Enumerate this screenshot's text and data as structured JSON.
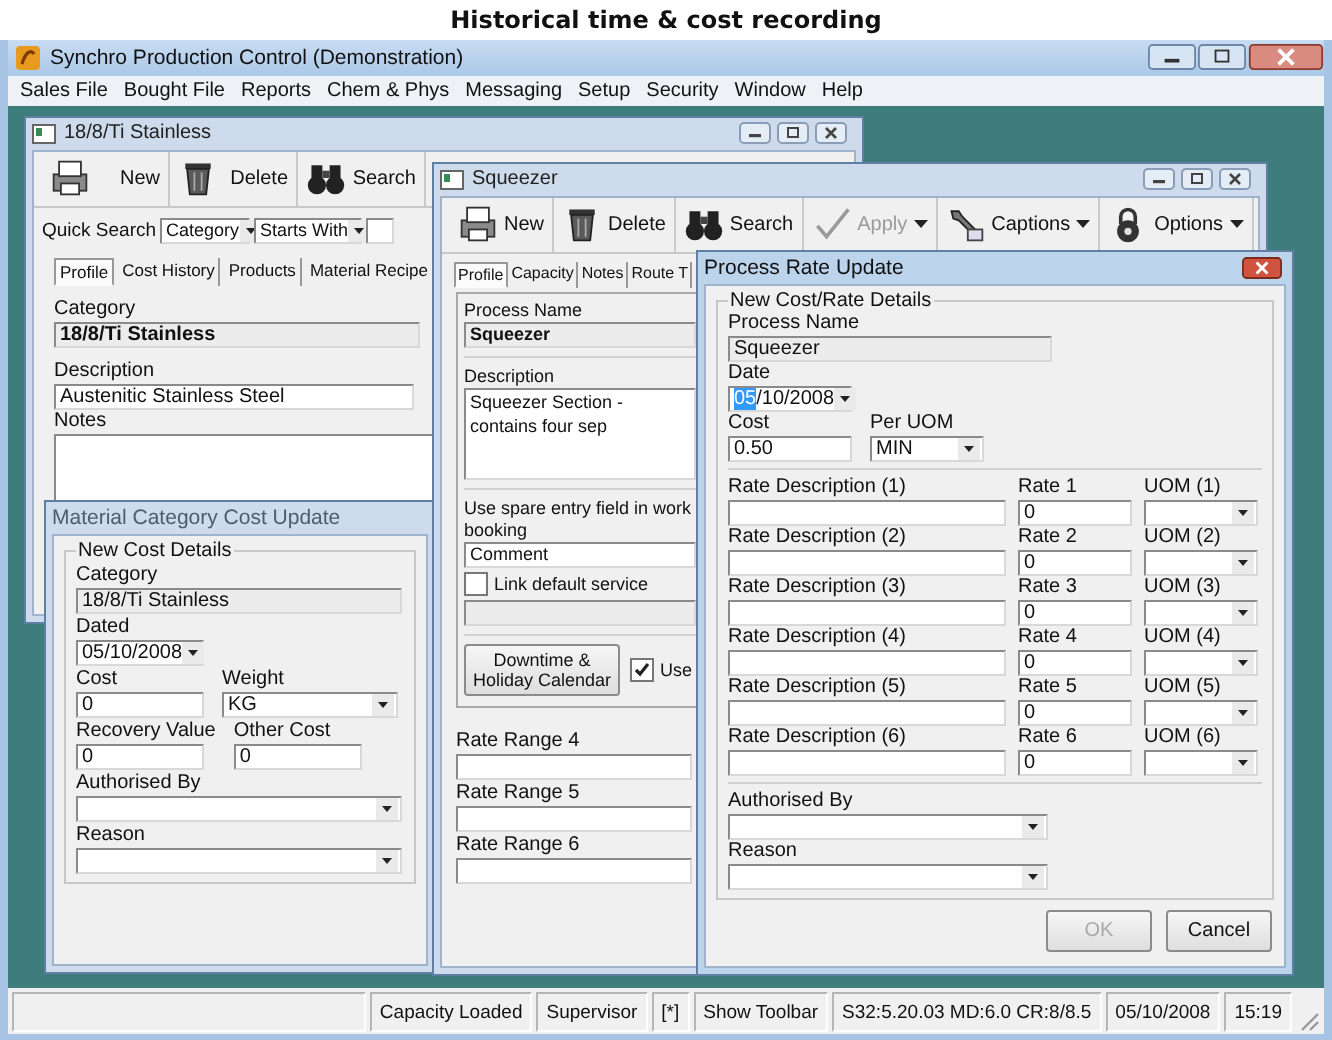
{
  "page_title": "Historical time & cost recording",
  "app": {
    "title": "Synchro Production Control (Demonstration)",
    "menu": [
      "Sales File",
      "Bought File",
      "Reports",
      "Chem & Phys",
      "Messaging",
      "Setup",
      "Security",
      "Window",
      "Help"
    ]
  },
  "material_window": {
    "title": "18/8/Ti Stainless",
    "toolbar": [
      {
        "kind": "new",
        "label": "New",
        "disabled": false,
        "dropdown": false
      },
      {
        "kind": "delete",
        "label": "Delete",
        "disabled": false,
        "dropdown": false
      },
      {
        "kind": "search",
        "label": "Search",
        "disabled": false,
        "dropdown": false
      }
    ],
    "quick_search": {
      "label": "Quick Search",
      "field": "Category",
      "match": "Starts With"
    },
    "tabs": [
      {
        "label": "Profile",
        "selected": true
      },
      {
        "label": "Cost History",
        "selected": false
      },
      {
        "label": "Products",
        "selected": false
      },
      {
        "label": "Material Recipe",
        "selected": false
      }
    ],
    "category": {
      "label": "Category",
      "value": "18/8/Ti Stainless"
    },
    "description": {
      "label": "Description",
      "value": "Austenitic Stainless Steel"
    },
    "notes": {
      "label": "Notes"
    }
  },
  "cost_update_dialog": {
    "title": "Material Category Cost Update",
    "group": "New Cost Details",
    "category": {
      "label": "Category",
      "value": "18/8/Ti Stainless",
      "read_only": true
    },
    "dated": {
      "label": "Dated",
      "value": "05/10/2008"
    },
    "cost": {
      "label": "Cost",
      "value": "0"
    },
    "weight": {
      "label": "Weight",
      "value": "KG"
    },
    "recovery_value": {
      "label": "Recovery Value",
      "value": "0"
    },
    "other_cost": {
      "label": "Other Cost",
      "value": "0"
    },
    "authorised_by": {
      "label": "Authorised By"
    },
    "reason": {
      "label": "Reason"
    }
  },
  "squeezer_window": {
    "title": "Squeezer",
    "toolbar": [
      {
        "kind": "new",
        "label": "New",
        "disabled": false,
        "dropdown": false
      },
      {
        "kind": "delete",
        "label": "Delete",
        "disabled": false,
        "dropdown": false
      },
      {
        "kind": "search",
        "label": "Search",
        "disabled": false,
        "dropdown": false
      },
      {
        "kind": "apply",
        "label": "Apply",
        "disabled": true,
        "dropdown": true
      },
      {
        "kind": "captions",
        "label": "Captions",
        "disabled": false,
        "dropdown": true
      },
      {
        "kind": "options",
        "label": "Options",
        "disabled": false,
        "dropdown": true
      }
    ],
    "tabs": [
      {
        "label": "Profile",
        "selected": true
      },
      {
        "label": "Capacity",
        "selected": false
      },
      {
        "label": "Notes",
        "selected": false
      },
      {
        "label": "Route T",
        "selected": false
      }
    ],
    "process_name": {
      "label": "Process Name",
      "value": "Squeezer",
      "read_only": true
    },
    "description": {
      "label": "Description",
      "value": "Squeezer Section - contains four sep"
    },
    "spare_entry": {
      "label": "Use spare entry field in work booking",
      "value": "Comment"
    },
    "link_default_service": {
      "label": "Link default service",
      "checked": false
    },
    "calendar_button": "Downtime & Holiday Calendar",
    "use_option": {
      "label": "Use",
      "checked": true
    },
    "rate_ranges": [
      "Rate Range 4",
      "Rate Range 5",
      "Rate Range 6"
    ]
  },
  "rate_dialog": {
    "title": "Process Rate Update",
    "group": "New Cost/Rate Details",
    "process_name": {
      "label": "Process Name",
      "value": "Squeezer",
      "read_only": true
    },
    "date": {
      "label": "Date",
      "value_parts": [
        {
          "text": "05",
          "selected": true
        },
        {
          "text": "/10/2008",
          "selected": false
        }
      ]
    },
    "cost": {
      "label": "Cost",
      "value": "0.50"
    },
    "per_uom": {
      "label": "Per UOM",
      "value": "MIN"
    },
    "rates": [
      {
        "description_label": "Rate Description (1)",
        "rate_label": "Rate 1",
        "rate": "0",
        "uom_label": "UOM (1)"
      },
      {
        "description_label": "Rate Description (2)",
        "rate_label": "Rate 2",
        "rate": "0",
        "uom_label": "UOM (2)"
      },
      {
        "description_label": "Rate Description (3)",
        "rate_label": "Rate 3",
        "rate": "0",
        "uom_label": "UOM (3)"
      },
      {
        "description_label": "Rate Description (4)",
        "rate_label": "Rate 4",
        "rate": "0",
        "uom_label": "UOM (4)"
      },
      {
        "description_label": "Rate Description (5)",
        "rate_label": "Rate 5",
        "rate": "0",
        "uom_label": "UOM (5)"
      },
      {
        "description_label": "Rate Description (6)",
        "rate_label": "Rate 6",
        "rate": "0",
        "uom_label": "UOM (6)"
      }
    ],
    "authorised_by": {
      "label": "Authorised By"
    },
    "reason": {
      "label": "Reason"
    },
    "buttons": [
      {
        "label": "OK",
        "disabled": true
      },
      {
        "label": "Cancel",
        "disabled": false
      }
    ]
  },
  "status_bar": [
    "Capacity Loaded",
    "Supervisor",
    "[*]",
    "Show Toolbar",
    "S32:5.20.03 MD:6.0 CR:8/8.5",
    "05/10/2008",
    "15:19"
  ]
}
